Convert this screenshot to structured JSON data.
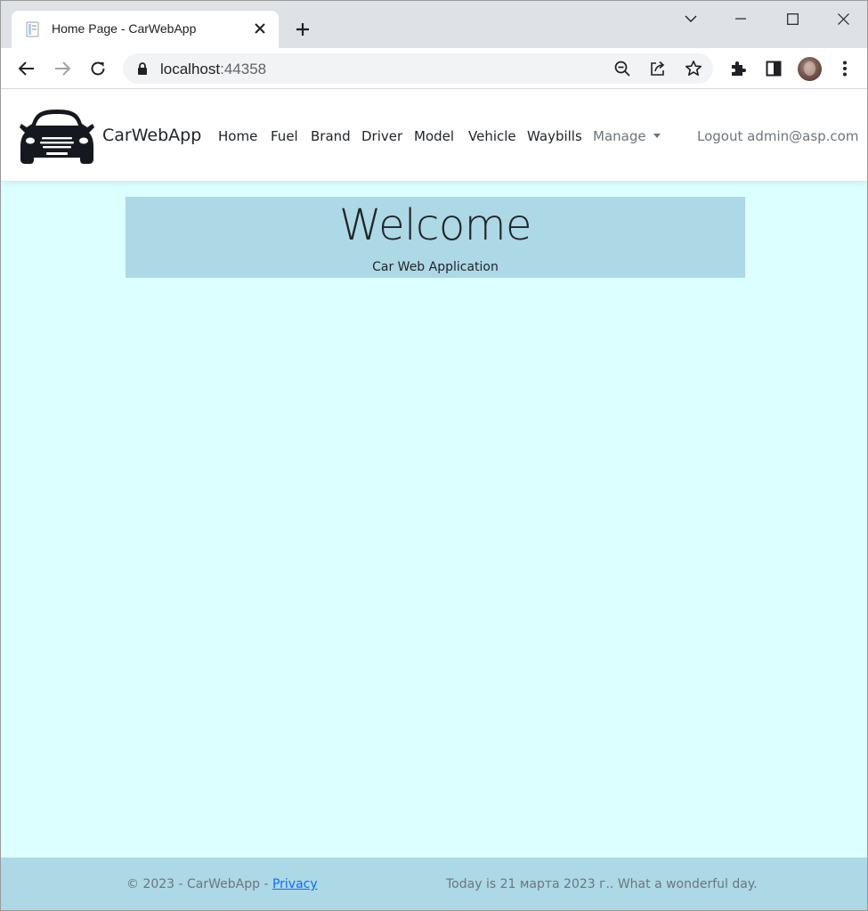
{
  "browser": {
    "tab_title": "Home Page - CarWebApp",
    "url_host": "localhost",
    "url_port": ":44358"
  },
  "navbar": {
    "brand": "CarWebApp",
    "links": [
      "Home",
      "Fuel",
      "Brand",
      "Driver",
      "Model",
      "Vehicle",
      "Waybills"
    ],
    "manage": "Manage",
    "logout": "Logout admin@asp.com"
  },
  "hero": {
    "title": "Welcome",
    "subtitle": "Car Web Application"
  },
  "footer": {
    "copyright": "© 2023 - CarWebApp - ",
    "privacy": "Privacy",
    "date_text": "Today is 21 марта 2023 г.. What a wonderful day."
  },
  "colors": {
    "page_background": "#dcffff",
    "hero_background": "#add8e6",
    "footer_background": "#add8e6",
    "link": "#0d6efd"
  }
}
